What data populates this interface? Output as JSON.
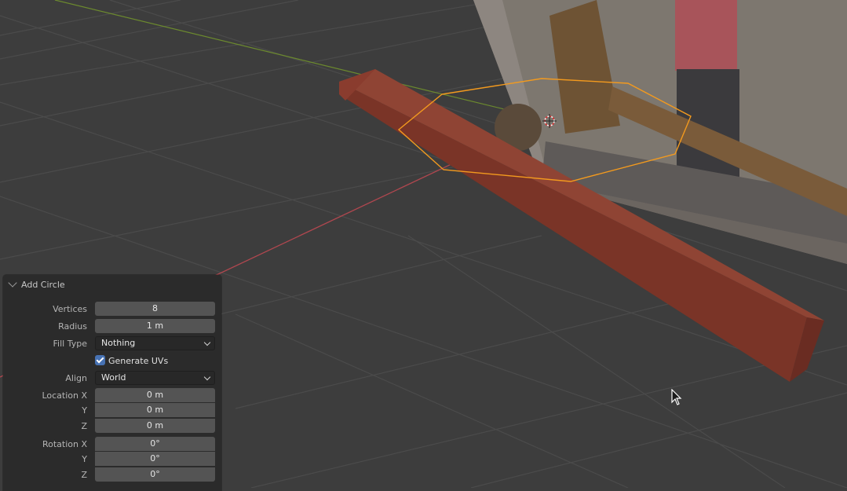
{
  "viewport": {
    "background": "#3d3d3d",
    "grid_color": "#4b4b4b",
    "x_axis_color": "#b0474f",
    "y_axis_color": "#6c8a2e",
    "object_color": "#8a3a2e",
    "selection_color": "#f39a1e"
  },
  "operator_panel": {
    "title": "Add Circle",
    "vertices_label": "Vertices",
    "vertices_value": "8",
    "radius_label": "Radius",
    "radius_value": "1 m",
    "fill_type_label": "Fill Type",
    "fill_type_value": "Nothing",
    "generate_uvs_label": "Generate UVs",
    "generate_uvs_checked": true,
    "align_label": "Align",
    "align_value": "World",
    "location_x_label": "Location X",
    "location_x_value": "0 m",
    "location_y_label": "Y",
    "location_y_value": "0 m",
    "location_z_label": "Z",
    "location_z_value": "0 m",
    "rotation_x_label": "Rotation X",
    "rotation_x_value": "0°",
    "rotation_y_label": "Y",
    "rotation_y_value": "0°",
    "rotation_z_label": "Z",
    "rotation_z_value": "0°"
  }
}
